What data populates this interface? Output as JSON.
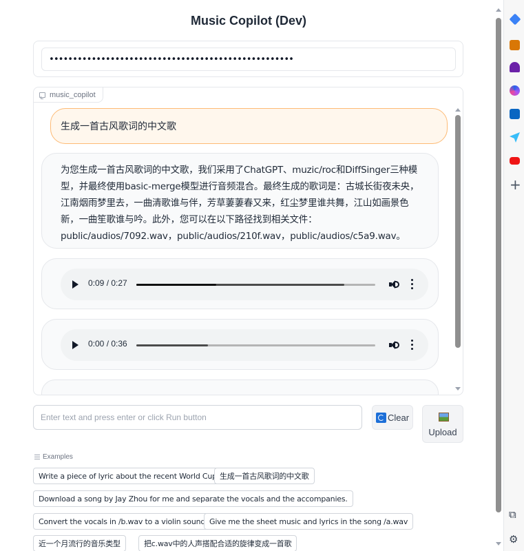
{
  "title": "Music Copilot (Dev)",
  "api_key": {
    "masked_value": "••••••••••••••••••••••••••••••••••••••••••••••••••••"
  },
  "chatbot": {
    "label": "music_copilot",
    "user_message": "生成一首古风歌词的中文歌",
    "bot_message": "为您生成一首古风歌词的中文歌，我们采用了ChatGPT、muzic/roc和DiffSinger三种模型，并最终使用basic-merge模型进行音频混合。最终生成的歌词是：古城长街夜未央，江南烟雨梦里去，一曲清歌谁与伴，芳草萋萋春又来，红尘梦里谁共舞，江山如画景色新，一曲笙歌谁与吟。此外，您可以在以下路径找到相关文件：public/audios/7092.wav，public/audios/210f.wav，public/audios/c5a9.wav。",
    "audio_players": [
      {
        "time": "0:09 / 0:27",
        "played_fraction": 0.3333,
        "buffered_fraction": 0.87
      },
      {
        "time": "0:00 / 0:36",
        "played_fraction": 0.0,
        "buffered_fraction": 0.3
      }
    ]
  },
  "input": {
    "placeholder": "Enter text and press enter or click Run button"
  },
  "buttons": {
    "clear_label": "Clear",
    "upload_label": "Upload"
  },
  "examples": {
    "label": "Examples",
    "items": [
      "Write a piece of lyric about the recent World Cup.",
      "生成一首古风歌词的中文歌",
      "Download a song by Jay Zhou for me and separate the vocals and the accompanies.",
      "Convert the vocals in /b.wav to a violin sound.",
      "Give me the sheet music and lyrics in the song /a.wav",
      "近一个月流行的音乐类型",
      "把c.wav中的人声搭配合适的旋律变成一首歌"
    ]
  },
  "icons": {
    "extensions": [
      "tag-icon",
      "briefcase-icon",
      "chess-icon",
      "copilot-icon",
      "outlook-icon",
      "telegram-icon",
      "youtube-icon",
      "add-icon",
      "screenshot-icon",
      "settings-icon"
    ]
  }
}
